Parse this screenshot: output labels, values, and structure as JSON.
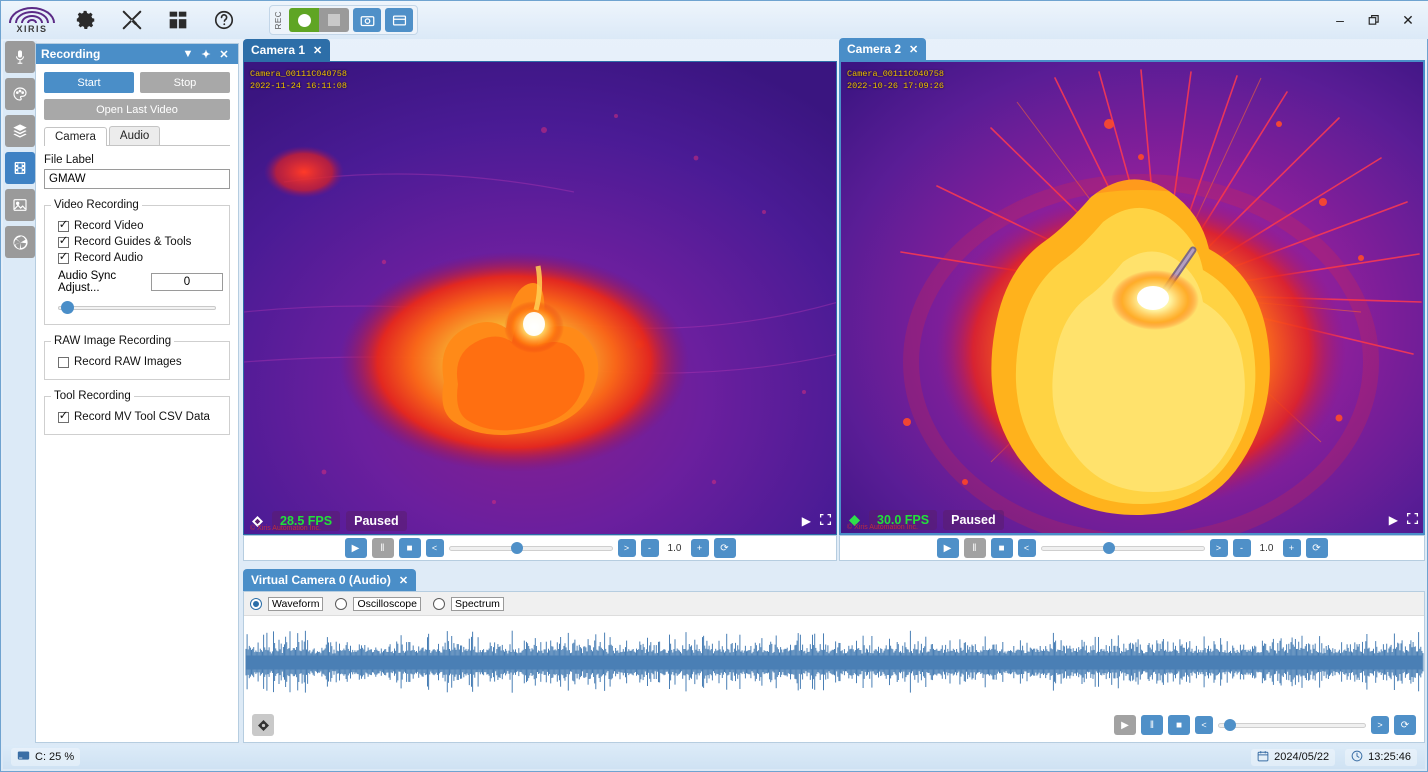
{
  "app": {
    "logo_text": "XIRIS",
    "rec_label": "REC"
  },
  "toolbar": {
    "icons": [
      {
        "name": "gear-icon",
        "label": "Settings"
      },
      {
        "name": "tools-icon",
        "label": "Tools"
      },
      {
        "name": "grid-icon",
        "label": "Layout"
      },
      {
        "name": "help-icon",
        "label": "Help"
      }
    ],
    "record_button": "Record",
    "stop_button": "Stop",
    "snapshot_button": "Snapshot",
    "window_button": "Window"
  },
  "window_controls": {
    "minimize": "–",
    "restore": "❐",
    "close": "✕"
  },
  "rail": {
    "items": [
      {
        "name": "microphone-icon",
        "label": "Audio"
      },
      {
        "name": "palette-icon",
        "label": "Color Palette"
      },
      {
        "name": "layers-icon",
        "label": "Layers"
      },
      {
        "name": "film-icon",
        "label": "Recording",
        "active": true
      },
      {
        "name": "image-icon",
        "label": "Images"
      },
      {
        "name": "aperture-icon",
        "label": "Camera Settings"
      }
    ]
  },
  "recording_panel": {
    "title": "Recording",
    "header_buttons": {
      "dropdown": "▼",
      "pin": "✦",
      "close": "✕"
    },
    "start_label": "Start",
    "stop_label": "Stop",
    "open_last_video_label": "Open Last Video",
    "tabs": [
      {
        "label": "Camera",
        "active": true
      },
      {
        "label": "Audio",
        "active": false
      }
    ],
    "file_label_title": "File Label",
    "file_label_value": "GMAW",
    "video_recording": {
      "legend": "Video Recording",
      "checkboxes": [
        {
          "label": "Record Video",
          "checked": true
        },
        {
          "label": "Record Guides & Tools",
          "checked": true
        },
        {
          "label": "Record Audio",
          "checked": true
        }
      ],
      "audio_sync_label": "Audio Sync Adjust...",
      "audio_sync_value": "0",
      "audio_sync_slider_pct": 2
    },
    "raw_image_recording": {
      "legend": "RAW Image Recording",
      "checkboxes": [
        {
          "label": "Record RAW Images",
          "checked": false
        }
      ]
    },
    "tool_recording": {
      "legend": "Tool Recording",
      "checkboxes": [
        {
          "label": "Record MV Tool CSV Data",
          "checked": true
        }
      ]
    }
  },
  "cameras": [
    {
      "tab_label": "Camera 1",
      "tab_close": "✕",
      "tab_active": false,
      "overlay_id": "Camera_00111C040758",
      "overlay_timestamp": "2022-11-24 16:11:08",
      "fps": "28.5 FPS",
      "state": "Paused",
      "copyright": "© Xiris Automation Inc.",
      "rate": "1.0",
      "seek_pct": 38,
      "status_indicator": "white-diamond-icon"
    },
    {
      "tab_label": "Camera 2",
      "tab_close": "✕",
      "tab_active": true,
      "overlay_id": "Camera_00111C040758",
      "overlay_timestamp": "2022-10-26 17:09:26",
      "fps": "30.0 FPS",
      "state": "Paused",
      "copyright": "© Xiris Automation Inc.",
      "rate": "1.0",
      "seek_pct": 38,
      "status_indicator": "green-diamond-icon"
    }
  ],
  "camera_controls": {
    "play": "▶",
    "pause": "‖",
    "stop": "■",
    "step_back": "<",
    "step_fwd": ">",
    "rate_minus": "-",
    "rate_plus": "+",
    "loop": "⟳",
    "overlay_play": "▶",
    "overlay_fullscreen": "⛶"
  },
  "audio_panel": {
    "tab_label": "Virtual Camera 0 (Audio)",
    "tab_close": "✕",
    "modes": [
      {
        "label": "Waveform",
        "selected": true
      },
      {
        "label": "Oscilloscope",
        "selected": false
      },
      {
        "label": "Spectrum",
        "selected": false
      }
    ],
    "settings_button": "audio-settings",
    "seek_pct": 4
  },
  "statusbar": {
    "disk": {
      "icon": "drive-icon",
      "text": "C: 25 %"
    },
    "date": {
      "icon": "calendar-icon",
      "text": "2024/05/22"
    },
    "time": {
      "icon": "clock-icon",
      "text": "13:25:46"
    }
  },
  "colors": {
    "accent": "#4a8ec8",
    "record_green": "#5fa524",
    "fps_green": "#22e03a",
    "overlay_yellow": "#f0c000",
    "waveform_blue": "#4a7fb5"
  }
}
